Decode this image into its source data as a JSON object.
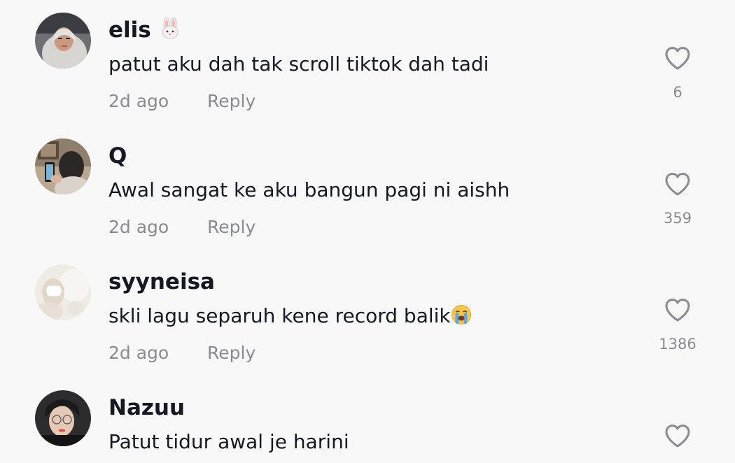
{
  "comments": [
    {
      "username": "elis",
      "username_emoji": "rabbit-face",
      "text": "patut aku dah tak scroll tiktok dah tadi",
      "time": "2d ago",
      "reply_label": "Reply",
      "likes": "6"
    },
    {
      "username": "Q",
      "text": "Awal sangat ke aku bangun pagi ni aishh",
      "time": "2d ago",
      "reply_label": "Reply",
      "likes": "359"
    },
    {
      "username": "syyneisa",
      "text": "skli lagu separuh kene record balik",
      "text_emoji": "loudly-crying-face",
      "time": "2d ago",
      "reply_label": "Reply",
      "likes": "1386"
    },
    {
      "username": "Nazuu",
      "text": "Patut tidur awal je harini"
    }
  ],
  "colors": {
    "background": "#f8f8f8",
    "primary_text": "#161823",
    "secondary_text": "#8a8b91",
    "heart_outline": "#8a8b91"
  }
}
